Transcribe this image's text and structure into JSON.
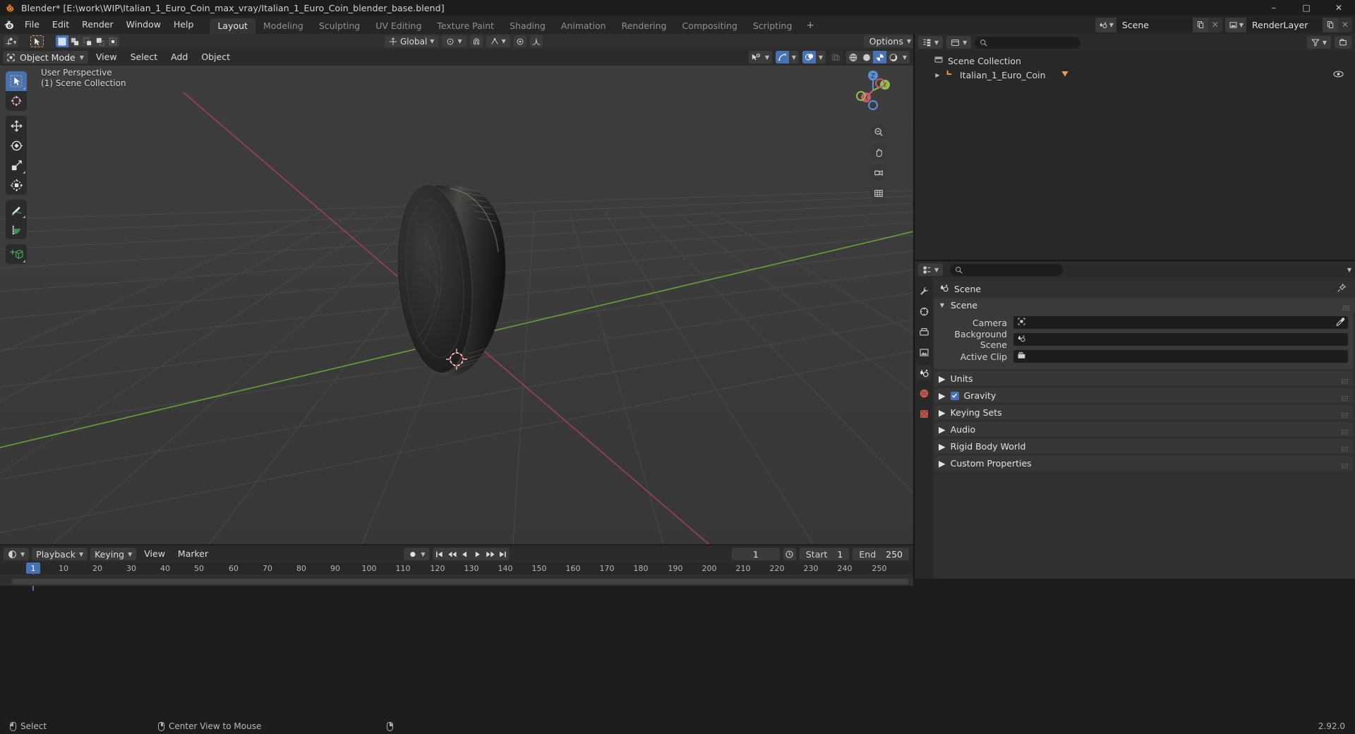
{
  "window": {
    "title": "Blender* [E:\\work\\WIP\\Italian_1_Euro_Coin_max_vray/Italian_1_Euro_Coin_blender_base.blend]",
    "minimize": "–",
    "maximize": "□",
    "close": "✕"
  },
  "topbar": {
    "menus": [
      "File",
      "Edit",
      "Render",
      "Window",
      "Help"
    ],
    "workspaces": [
      {
        "label": "Layout",
        "active": true
      },
      {
        "label": "Modeling",
        "active": false
      },
      {
        "label": "Sculpting",
        "active": false
      },
      {
        "label": "UV Editing",
        "active": false
      },
      {
        "label": "Texture Paint",
        "active": false
      },
      {
        "label": "Shading",
        "active": false
      },
      {
        "label": "Animation",
        "active": false
      },
      {
        "label": "Rendering",
        "active": false
      },
      {
        "label": "Compositing",
        "active": false
      },
      {
        "label": "Scripting",
        "active": false
      }
    ],
    "add_workspace": "+",
    "scene_name": "Scene",
    "viewlayer_name": "RenderLayer"
  },
  "tool_settings": {
    "transform_orientation": "Global",
    "options_label": "Options"
  },
  "viewport": {
    "mode": "Object Mode",
    "menus": [
      "View",
      "Select",
      "Add",
      "Object"
    ],
    "overlay_line1": "User Perspective",
    "overlay_line2": "(1) Scene Collection",
    "gizmo_axes": {
      "z": "Z",
      "y": "Y",
      "x": "X"
    },
    "tools": [
      "tweak-select-tool",
      "cursor-tool",
      "move-tool",
      "rotate-tool",
      "scale-tool",
      "transform-tool",
      "annotate-tool",
      "measure-tool",
      "add-cube-tool"
    ],
    "nav_buttons": [
      "zoom-nav-button",
      "pan-nav-button",
      "camera-nav-button",
      "ortho-nav-button"
    ]
  },
  "outliner": {
    "display_mode": "View Layer",
    "rows": [
      {
        "label": "Scene Collection",
        "indent": 0,
        "icon": "collection-icon",
        "has_twirl": false,
        "eye": false
      },
      {
        "label": "Italian_1_Euro_Coin",
        "indent": 1,
        "icon": "object-icon",
        "has_twirl": true,
        "eye": true
      }
    ]
  },
  "properties": {
    "breadcrumb": "Scene",
    "tabs": [
      "tool-tab",
      "render-tab",
      "output-tab",
      "view-layer-tab",
      "scene-tab",
      "world-tab",
      "texture-tab"
    ],
    "active_tab": "scene-tab",
    "panel_title": "Scene",
    "fields": [
      {
        "label": "Camera",
        "value": "",
        "icon": "camera-icon",
        "eyedropper": true
      },
      {
        "label": "Background Scene",
        "value": "",
        "icon": "scene-icon",
        "eyedropper": false
      },
      {
        "label": "Active Clip",
        "value": "",
        "icon": "clip-icon",
        "eyedropper": false
      }
    ],
    "sub_panels": [
      {
        "label": "Units",
        "checkbox": false
      },
      {
        "label": "Gravity",
        "checkbox": true,
        "checked": true
      },
      {
        "label": "Keying Sets",
        "checkbox": false
      },
      {
        "label": "Audio",
        "checkbox": false
      },
      {
        "label": "Rigid Body World",
        "checkbox": false
      },
      {
        "label": "Custom Properties",
        "checkbox": false
      }
    ]
  },
  "timeline": {
    "menus": [
      {
        "label": "Playback",
        "dropdown": true
      },
      {
        "label": "Keying",
        "dropdown": true
      },
      {
        "label": "View",
        "dropdown": false
      },
      {
        "label": "Marker",
        "dropdown": false
      }
    ],
    "current_frame": "1",
    "start_label": "Start",
    "start_value": "1",
    "end_label": "End",
    "end_value": "250",
    "ticks": [
      "10",
      "20",
      "30",
      "40",
      "50",
      "60",
      "70",
      "80",
      "90",
      "100",
      "110",
      "120",
      "130",
      "140",
      "150",
      "160",
      "170",
      "180",
      "190",
      "200",
      "210",
      "220",
      "230",
      "240",
      "250"
    ],
    "playhead_frame": "1"
  },
  "statusbar": {
    "items": [
      {
        "mouse": "left",
        "label": "Select"
      },
      {
        "mouse": "mid",
        "label": "Center View to Mouse"
      },
      {
        "mouse": "right",
        "label": ""
      }
    ],
    "version": "2.92.0"
  },
  "colors": {
    "accent": "#4772b3",
    "x_axis": "#a4424f",
    "y_axis": "#6ea53b",
    "orange": "#e79d4f"
  }
}
